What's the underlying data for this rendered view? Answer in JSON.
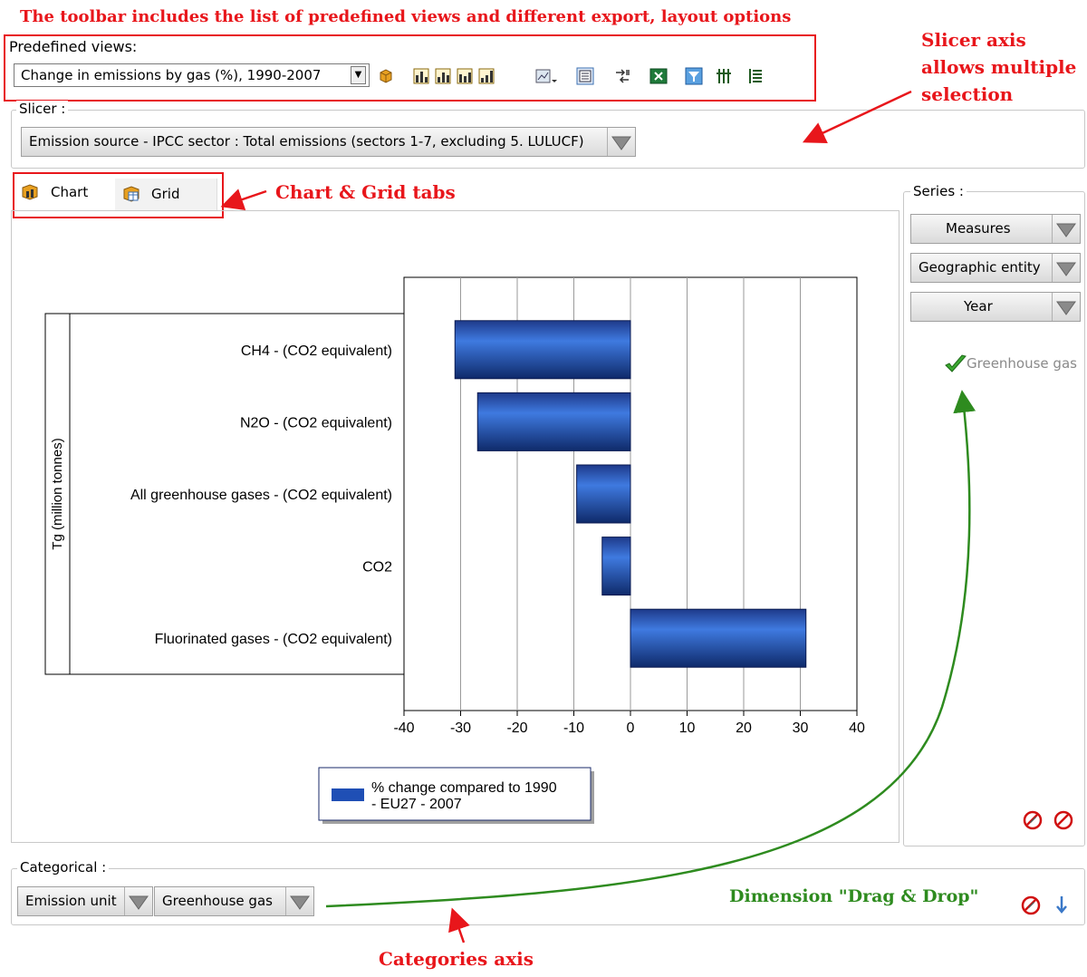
{
  "annotations": {
    "toolbar_note": "The toolbar includes the list of predefined views and different export, layout options",
    "slicer_note_1": "Slicer axis",
    "slicer_note_2": "allows multiple",
    "slicer_note_3": "selection",
    "tabs_note": "Chart & Grid tabs",
    "dragdrop_note": "Dimension \"Drag & Drop\"",
    "categories_note": "Categories axis"
  },
  "toolbar": {
    "predefined_label": "Predefined views:",
    "predefined_value": "Change in emissions by gas (%), 1990-2007"
  },
  "slicer": {
    "label": "Slicer :",
    "value": "Emission source - IPCC sector : Total emissions (sectors 1-7, excluding 5. LULUCF)"
  },
  "tabs": {
    "chart": "Chart",
    "grid": "Grid"
  },
  "series": {
    "label": "Series :",
    "items": [
      "Measures",
      "Geographic entity",
      "Year"
    ],
    "checked_item": "Greenhouse gas"
  },
  "categorical": {
    "label": "Categorical :",
    "items": [
      "Emission unit",
      "Greenhouse gas"
    ]
  },
  "chart_data": {
    "type": "bar",
    "orientation": "horizontal",
    "categories": [
      "CH4 - (CO2 equivalent)",
      "N2O - (CO2 equivalent)",
      "All greenhouse gases - (CO2 equivalent)",
      "CO2",
      "Fluorinated gases - (CO2 equivalent)"
    ],
    "values": [
      -31,
      -27,
      -9.5,
      -5,
      31
    ],
    "ylabel": "Tg (million tonnes)",
    "xlim": [
      -40,
      40
    ],
    "xticks": [
      "-40",
      "-30",
      "-20",
      "-10",
      "0",
      "10",
      "20",
      "30",
      "40"
    ],
    "grid": true,
    "legend": "bottom",
    "series": [
      {
        "name": "% change compared to 1990 - EU27 - 2007",
        "color": "#1f4fb5"
      }
    ],
    "legend_line1": "% change compared to 1990",
    "legend_line2": "- EU27 - 2007"
  }
}
